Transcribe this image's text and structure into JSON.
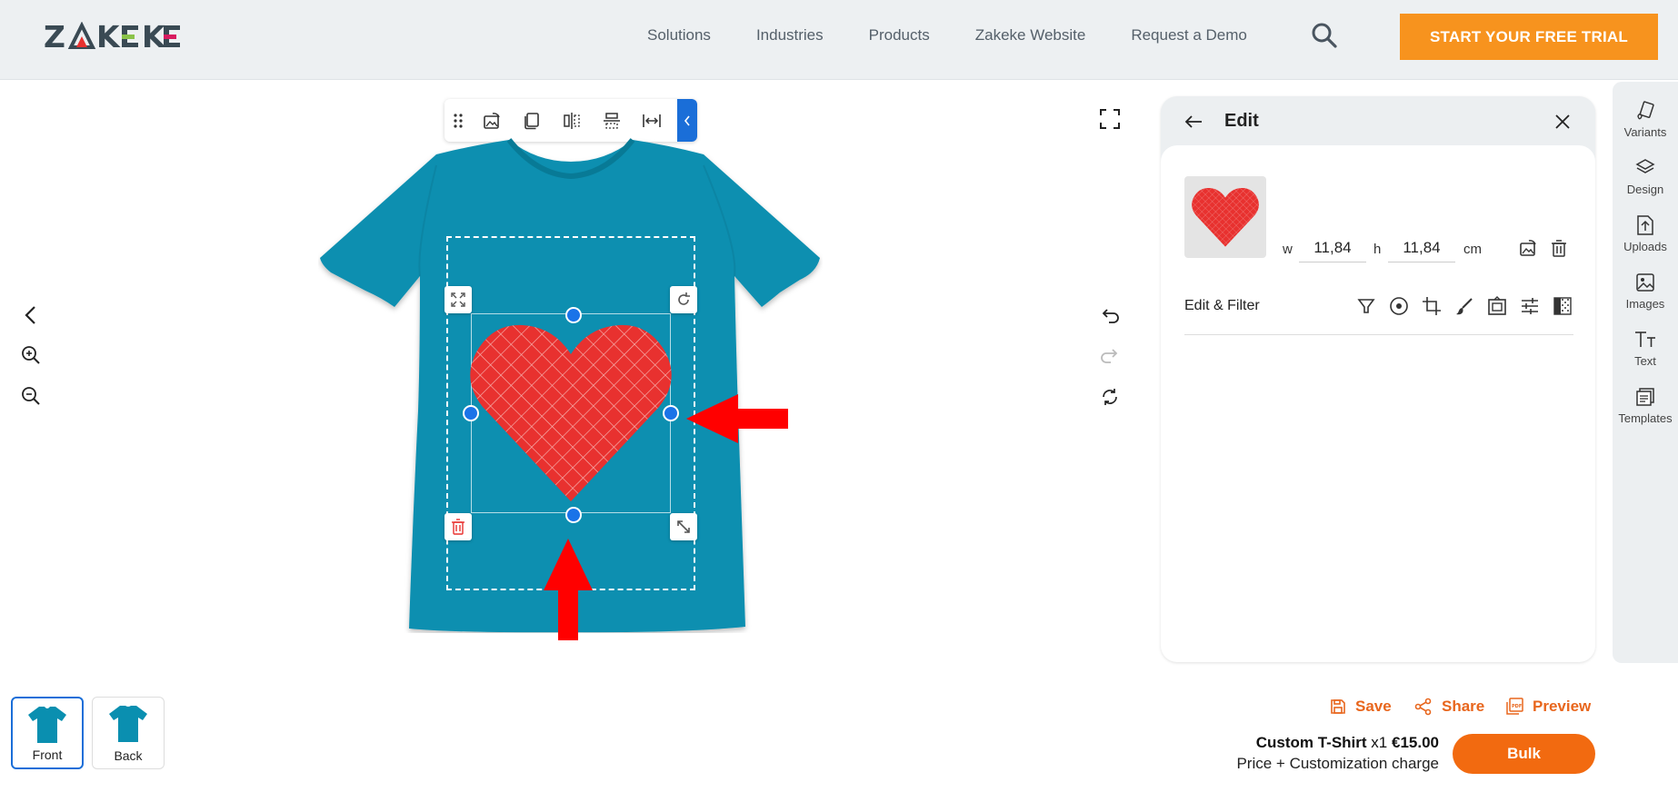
{
  "header": {
    "logo": "ZAKEKE",
    "nav": [
      "Solutions",
      "Industries",
      "Products",
      "Zakeke Website",
      "Request a Demo"
    ],
    "search_icon": "search-icon",
    "trial_button": "START YOUR FREE TRIAL",
    "accent": "#f7931e"
  },
  "toolbar": {
    "icons": [
      "drag-grip-icon",
      "replace-image-icon",
      "duplicate-icon",
      "flip-horizontal-icon",
      "flip-vertical-icon",
      "stretch-width-icon",
      "collapse-chevron-icon"
    ]
  },
  "left_tools": [
    "chevron-left-icon",
    "zoom-in-icon",
    "zoom-out-icon"
  ],
  "right_tools": [
    "fullscreen-icon",
    "undo-icon",
    "redo-icon",
    "reset-icon"
  ],
  "edit_panel": {
    "title": "Edit",
    "width_label": "w",
    "width_value": "11,84",
    "height_label": "h",
    "height_value": "11,84",
    "unit": "cm",
    "filter_label": "Edit & Filter",
    "filter_icons": [
      "filter-icon",
      "circle-mask-icon",
      "crop-icon",
      "brush-icon",
      "frame-icon",
      "adjust-icon",
      "gradient-icon"
    ]
  },
  "sidebar": {
    "items": [
      {
        "label": "Variants",
        "icon": "variants-icon"
      },
      {
        "label": "Design",
        "icon": "layers-icon"
      },
      {
        "label": "Uploads",
        "icon": "upload-icon"
      },
      {
        "label": "Images",
        "icon": "image-icon"
      },
      {
        "label": "Text",
        "icon": "text-icon"
      },
      {
        "label": "Templates",
        "icon": "templates-icon"
      }
    ]
  },
  "sides": [
    {
      "label": "Front",
      "active": true
    },
    {
      "label": "Back",
      "active": false
    }
  ],
  "actions": {
    "save": "Save",
    "share": "Share",
    "preview": "Preview"
  },
  "product": {
    "name": "Custom T-Shirt",
    "quantity": "x1",
    "price": "€15.00",
    "note": "Price + Customization charge",
    "bulk_button": "Bulk"
  },
  "colors": {
    "shirt": "#0a8fb0",
    "heart": "#e8312f",
    "selection_handle": "#1a73e8",
    "action_orange": "#e8661d",
    "bulk_orange": "#f26a10"
  }
}
